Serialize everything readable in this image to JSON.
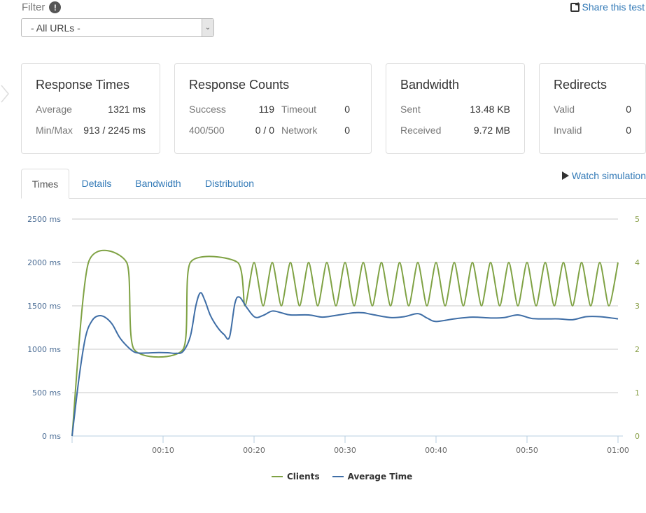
{
  "filter": {
    "label": "Filter",
    "info_icon": "exclamation-icon",
    "selected": "- All URLs -"
  },
  "share": {
    "label": "Share this test",
    "icon": "share-icon"
  },
  "cards": {
    "response_times": {
      "title": "Response Times",
      "rows": [
        {
          "label": "Average",
          "value": "1321 ms"
        },
        {
          "label": "Min/Max",
          "value": "913 / 2245 ms"
        }
      ]
    },
    "response_counts": {
      "title": "Response Counts",
      "rows": [
        {
          "label": "Success",
          "value": "119",
          "label2": "Timeout",
          "value2": "0"
        },
        {
          "label": "400/500",
          "value": "0 / 0",
          "label2": "Network",
          "value2": "0"
        }
      ]
    },
    "bandwidth": {
      "title": "Bandwidth",
      "rows": [
        {
          "label": "Sent",
          "value": "13.48 KB"
        },
        {
          "label": "Received",
          "value": "9.72 MB"
        }
      ]
    },
    "redirects": {
      "title": "Redirects",
      "rows": [
        {
          "label": "Valid",
          "value": "0"
        },
        {
          "label": "Invalid",
          "value": "0"
        }
      ]
    }
  },
  "tabs": [
    {
      "label": "Times",
      "active": true
    },
    {
      "label": "Details"
    },
    {
      "label": "Bandwidth"
    },
    {
      "label": "Distribution"
    }
  ],
  "watch": {
    "label": "Watch simulation",
    "icon": "play-icon"
  },
  "colors": {
    "clients": "#7fa244",
    "average_time": "#3f6ea6",
    "link": "#337ab7"
  },
  "chart_data": {
    "type": "line",
    "title": "",
    "xlabel": "",
    "ylabel": "",
    "x_unit": "seconds",
    "xlim": [
      0,
      60
    ],
    "x_ticks": [
      {
        "value": 10,
        "label": "00:10"
      },
      {
        "value": 20,
        "label": "00:20"
      },
      {
        "value": 30,
        "label": "00:30"
      },
      {
        "value": 40,
        "label": "00:40"
      },
      {
        "value": 50,
        "label": "00:50"
      },
      {
        "value": 60,
        "label": "01:00"
      }
    ],
    "y_left": {
      "range": [
        0,
        2500
      ],
      "ticks": [
        0,
        500,
        1000,
        1500,
        2000,
        2500
      ],
      "tick_labels": [
        "0 ms",
        "500 ms",
        "1000 ms",
        "1500 ms",
        "2000 ms",
        "2500 ms"
      ]
    },
    "y_right": {
      "range": [
        0,
        5
      ],
      "ticks": [
        0,
        1,
        2,
        3,
        4,
        5
      ],
      "tick_labels": [
        "0",
        "1",
        "2",
        "3",
        "4",
        "5"
      ]
    },
    "grid": true,
    "legend": "bottom-center",
    "series": [
      {
        "name": "Clients",
        "axis": "right",
        "points": [
          [
            0,
            0
          ],
          [
            1.8,
            4
          ],
          [
            6,
            4
          ],
          [
            6.8,
            2
          ],
          [
            12.2,
            2
          ],
          [
            13,
            4
          ],
          [
            18.2,
            4
          ],
          [
            19,
            3
          ],
          [
            20,
            4
          ],
          [
            21,
            3
          ],
          [
            22,
            4
          ],
          [
            23,
            3
          ],
          [
            24,
            4
          ],
          [
            25,
            3
          ],
          [
            26,
            4
          ],
          [
            27,
            3
          ],
          [
            28,
            4
          ],
          [
            29,
            3
          ],
          [
            30,
            4
          ],
          [
            31,
            3
          ],
          [
            32,
            4
          ],
          [
            33,
            3
          ],
          [
            34,
            4
          ],
          [
            35,
            3
          ],
          [
            36,
            4
          ],
          [
            37,
            3
          ],
          [
            38,
            4
          ],
          [
            39,
            3
          ],
          [
            40,
            4
          ],
          [
            41,
            3
          ],
          [
            42,
            4
          ],
          [
            43,
            3
          ],
          [
            44,
            4
          ],
          [
            45,
            3
          ],
          [
            46,
            4
          ],
          [
            47,
            3
          ],
          [
            48,
            4
          ],
          [
            49,
            3
          ],
          [
            50,
            4
          ],
          [
            51,
            3
          ],
          [
            52,
            4
          ],
          [
            53,
            3
          ],
          [
            54,
            4
          ],
          [
            55,
            3
          ],
          [
            56,
            4
          ],
          [
            57,
            3
          ],
          [
            58,
            4
          ],
          [
            59,
            3
          ],
          [
            60,
            4
          ]
        ]
      },
      {
        "name": "Average Time",
        "axis": "left",
        "points": [
          [
            0,
            0
          ],
          [
            0.8,
            700
          ],
          [
            1.5,
            1150
          ],
          [
            2.2,
            1330
          ],
          [
            2.9,
            1385
          ],
          [
            3.6,
            1370
          ],
          [
            4.4,
            1290
          ],
          [
            5.2,
            1140
          ],
          [
            6,
            1040
          ],
          [
            6.8,
            970
          ],
          [
            7.5,
            955
          ],
          [
            8.5,
            958
          ],
          [
            9.5,
            962
          ],
          [
            10.5,
            960
          ],
          [
            11.4,
            953
          ],
          [
            12.2,
            975
          ],
          [
            13,
            1150
          ],
          [
            13.6,
            1500
          ],
          [
            14.1,
            1650
          ],
          [
            14.6,
            1560
          ],
          [
            15.2,
            1390
          ],
          [
            16,
            1250
          ],
          [
            16.7,
            1170
          ],
          [
            17.3,
            1140
          ],
          [
            17.9,
            1530
          ],
          [
            18.4,
            1600
          ],
          [
            19.2,
            1480
          ],
          [
            20.1,
            1370
          ],
          [
            21,
            1390
          ],
          [
            22,
            1440
          ],
          [
            23,
            1420
          ],
          [
            24,
            1395
          ],
          [
            26,
            1395
          ],
          [
            27.5,
            1370
          ],
          [
            29,
            1390
          ],
          [
            31,
            1420
          ],
          [
            32,
            1420
          ],
          [
            33,
            1400
          ],
          [
            35,
            1365
          ],
          [
            36.5,
            1375
          ],
          [
            38,
            1410
          ],
          [
            39,
            1360
          ],
          [
            40,
            1320
          ],
          [
            42,
            1350
          ],
          [
            44,
            1370
          ],
          [
            46,
            1360
          ],
          [
            47.5,
            1365
          ],
          [
            49,
            1395
          ],
          [
            50.5,
            1355
          ],
          [
            52,
            1350
          ],
          [
            53.5,
            1350
          ],
          [
            55,
            1340
          ],
          [
            56.5,
            1375
          ],
          [
            58,
            1375
          ],
          [
            60,
            1350
          ]
        ]
      }
    ]
  }
}
